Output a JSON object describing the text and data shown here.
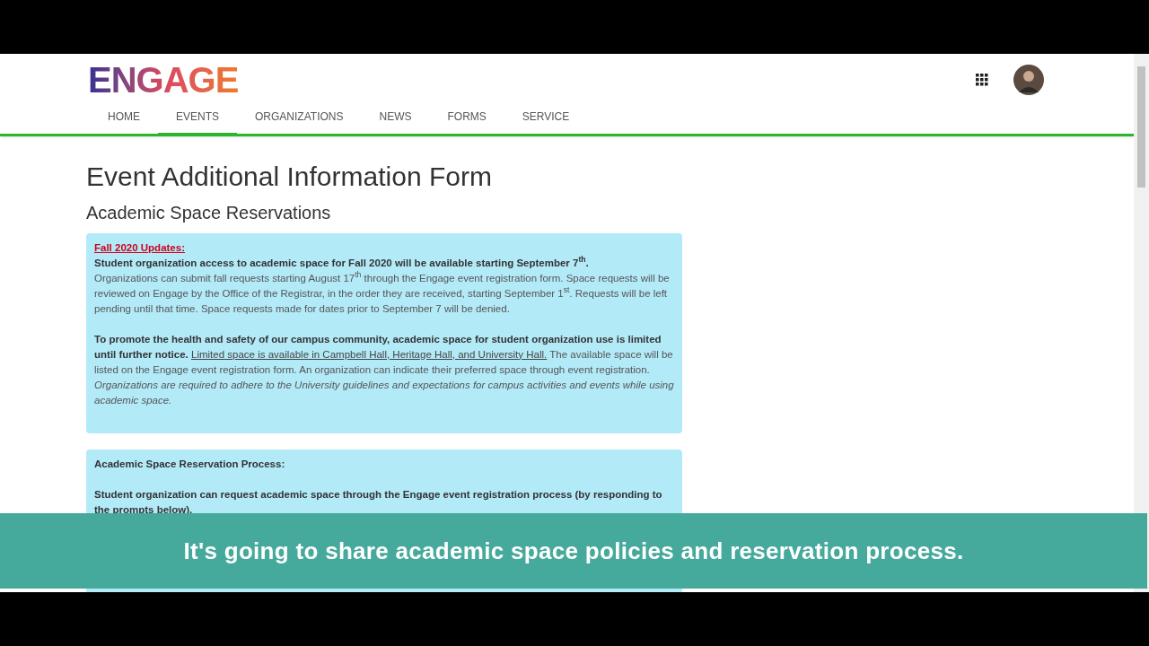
{
  "logo": "ENGAGE",
  "nav": [
    {
      "label": "HOME",
      "selected": false
    },
    {
      "label": "EVENTS",
      "selected": true
    },
    {
      "label": "ORGANIZATIONS",
      "selected": false
    },
    {
      "label": "NEWS",
      "selected": false
    },
    {
      "label": "FORMS",
      "selected": false
    },
    {
      "label": "SERVICE",
      "selected": false
    }
  ],
  "page_title": "Event Additional Information Form",
  "section_title": "Academic Space Reservations",
  "updates_box": {
    "heading": "Fall 2020 Updates:",
    "lead": "Student organization access to academic space for Fall 2020 will be available starting September 7$^{th}$.",
    "details": "Organizations can submit fall requests starting August 17$^{th}$ through the Engage event registration form. Space requests will be reviewed on Engage by the Office of the Registrar, in the order they are received, starting September 1$^{st}$. Requests will be left pending until that time. Space requests made for dates prior to September 7 will be denied.",
    "notice": [
      {
        "kind": "bold",
        "text": "To promote the health and safety of our campus community, academic space for student organization use is limited until further notice."
      },
      {
        "kind": "link",
        "text": "Limited space is available in Campbell Hall, Heritage Hall, and University Hall."
      },
      {
        "kind": "plain",
        "text": "The available space will be listed on the Engage event registration form. An organization can indicate their preferred space through event registration."
      },
      {
        "kind": "italic",
        "text": "Organizations are required to adhere to the University guidelines and expectations for campus activities and events while using academic space."
      }
    ]
  },
  "process_box": {
    "heading": "Academic Space Reservation Process:",
    "lead": "Student organization can request academic space through the Engage event registration process (by responding to the prompts below)."
  },
  "caption": "It's going to share academic space policies and reservation process."
}
